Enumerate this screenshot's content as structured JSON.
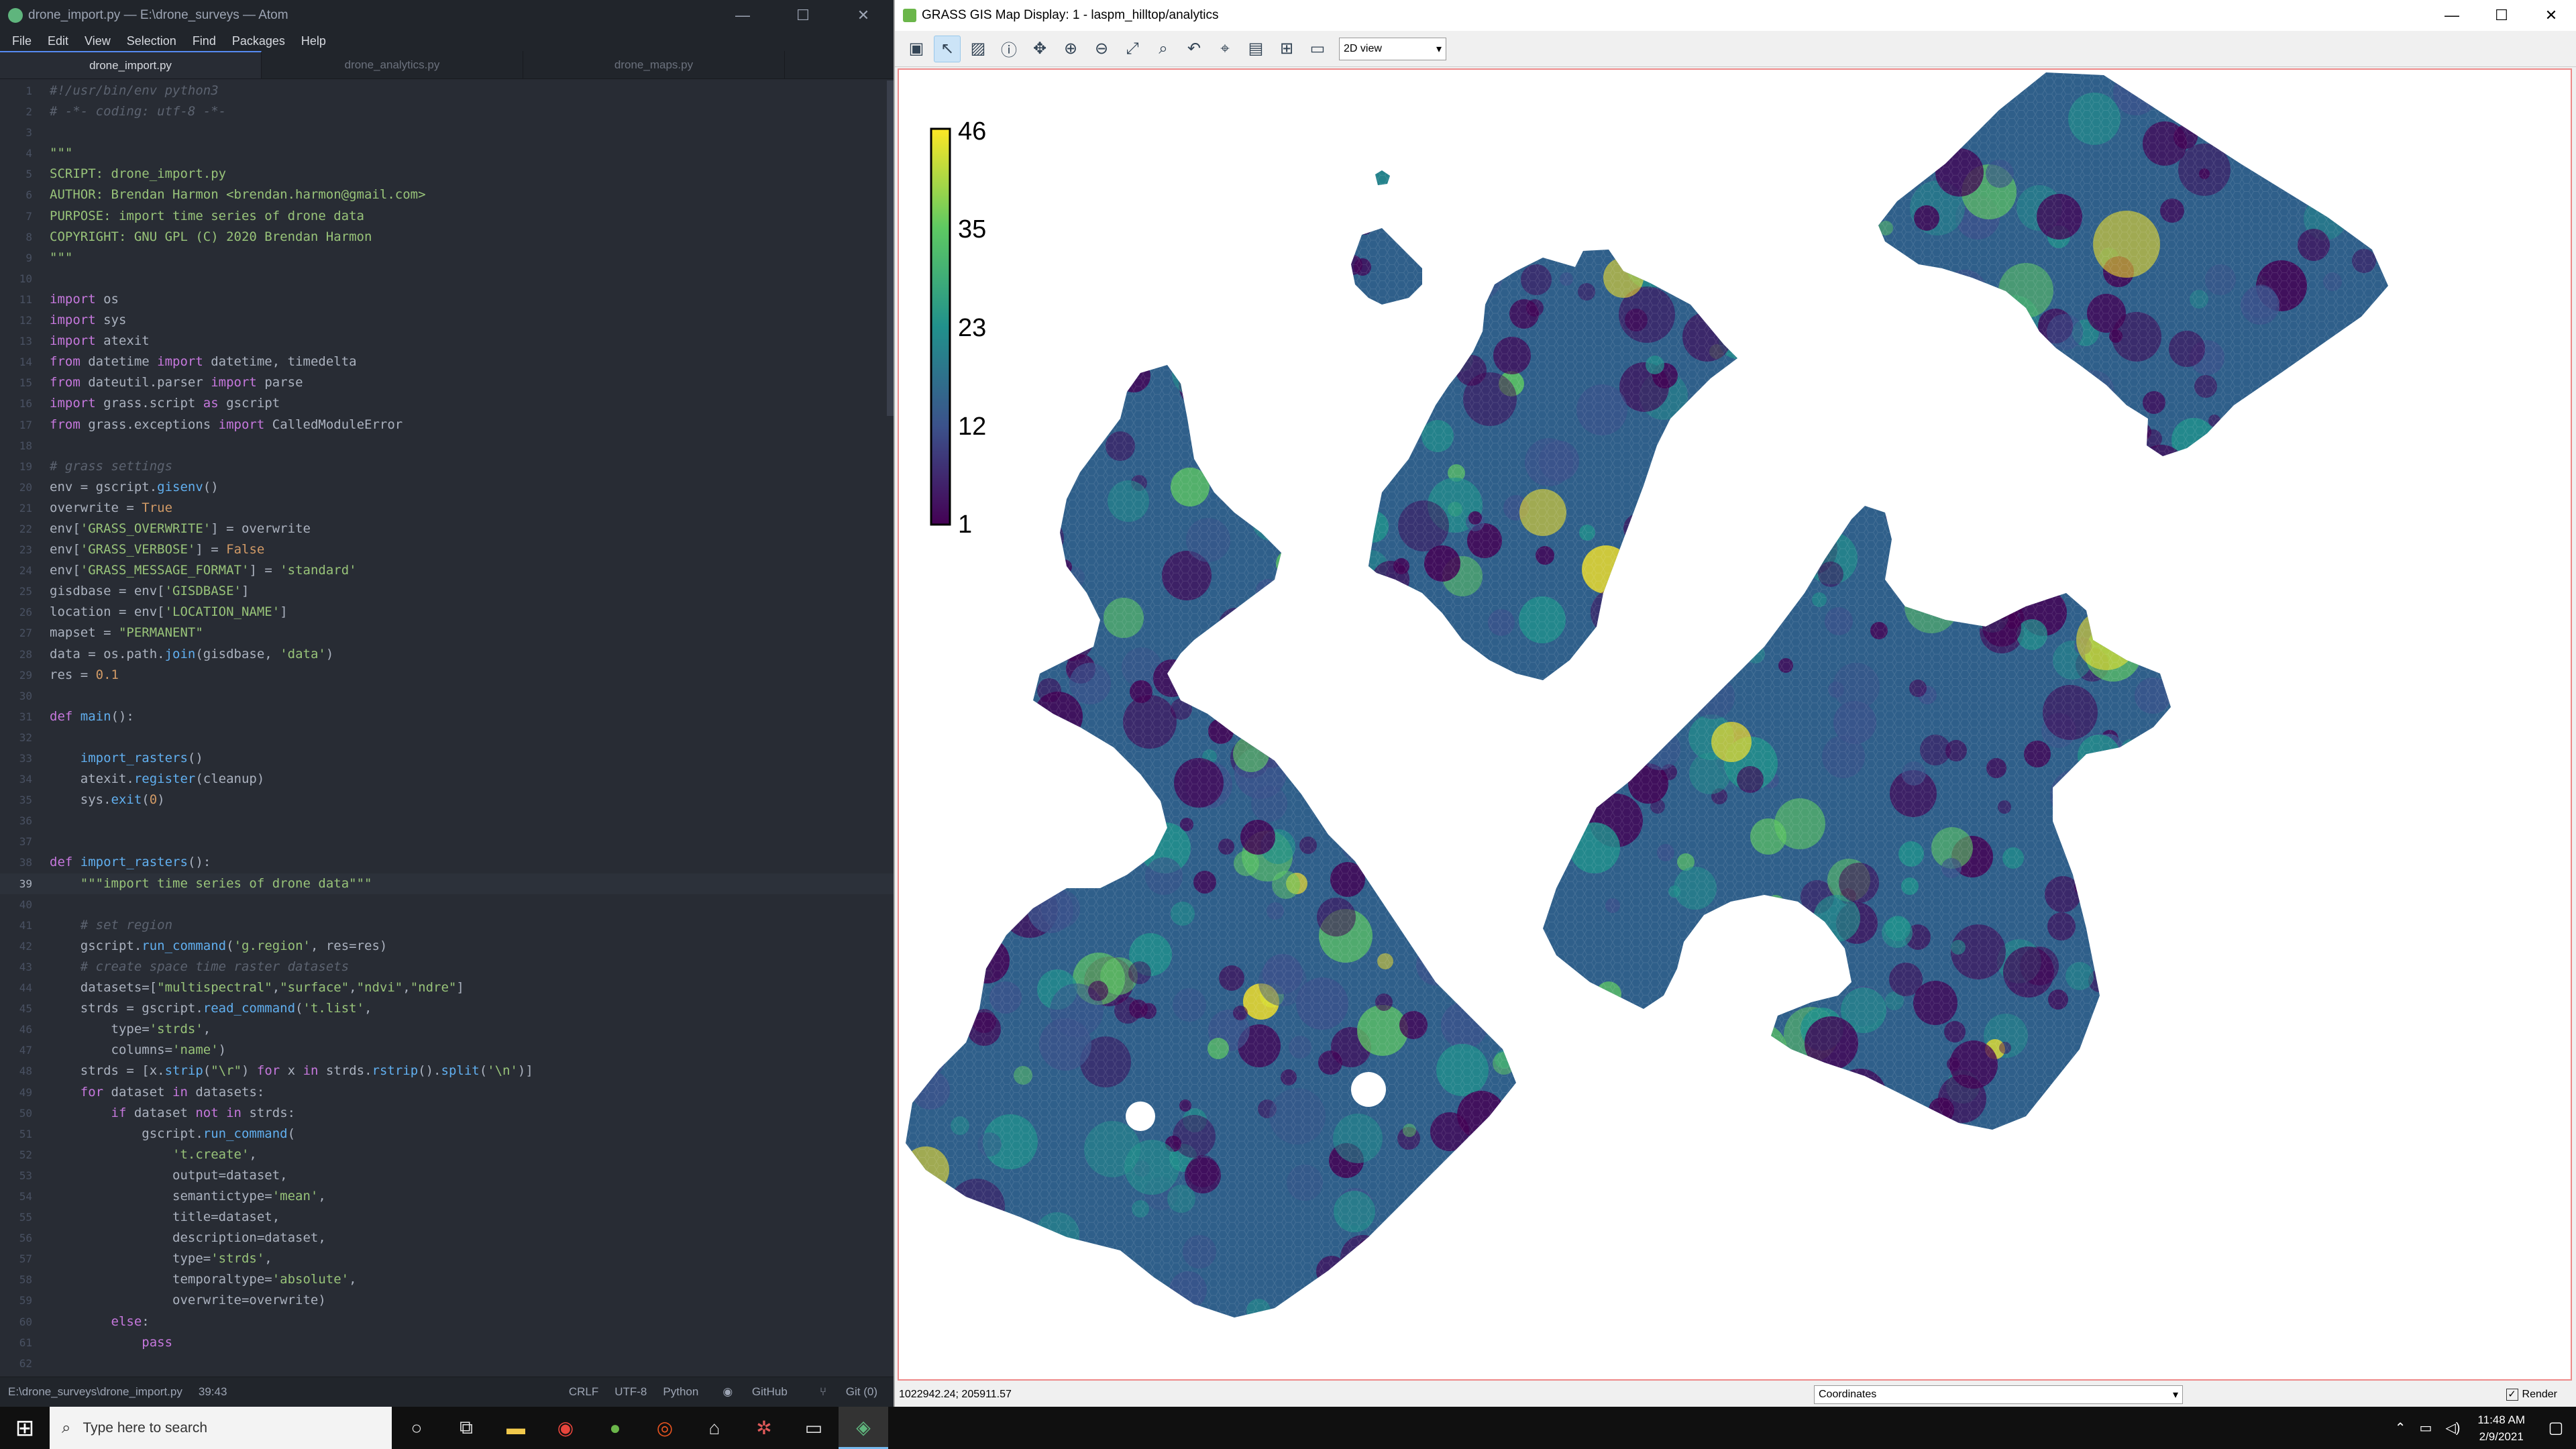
{
  "atom": {
    "title": "drone_import.py — E:\\drone_surveys — Atom",
    "menu": [
      "File",
      "Edit",
      "View",
      "Selection",
      "Find",
      "Packages",
      "Help"
    ],
    "tabs": [
      {
        "label": "drone_import.py",
        "active": true
      },
      {
        "label": "drone_analytics.py",
        "active": false
      },
      {
        "label": "drone_maps.py",
        "active": false
      }
    ],
    "status": {
      "path": "E:\\drone_surveys\\drone_import.py",
      "position": "39:43",
      "line_ending": "CRLF",
      "encoding": "UTF-8",
      "grammar": "Python",
      "github": "GitHub",
      "git": "Git (0)"
    }
  },
  "grass": {
    "title": "GRASS GIS Map Display: 1 - laspm_hilltop/analytics",
    "view_mode": "2D view",
    "coords": "1022942.24; 205911.57",
    "coords_mode": "Coordinates",
    "render_label": "Render",
    "legend": {
      "ticks": [
        "46",
        "35",
        "23",
        "12",
        "1"
      ],
      "min": 1,
      "max": 46
    }
  },
  "taskbar": {
    "search_placeholder": "Type here to search",
    "time": "11:48 AM",
    "date": "2/9/2021"
  },
  "window_controls": {
    "minimize": "—",
    "maximize": "☐",
    "close": "✕"
  },
  "toolbar_icons": [
    "display-map-icon",
    "pointer-icon",
    "select-icon",
    "query-icon",
    "pan-icon",
    "zoom-in-icon",
    "zoom-out-icon",
    "zoom-extent-icon",
    "zoom-region-icon",
    "zoom-back-icon",
    "zoom-menu-icon",
    "analyze-icon",
    "overlay-icon",
    "save-icon"
  ],
  "colors": {
    "viridis": [
      "#440154",
      "#3b528b",
      "#21918c",
      "#5ec962",
      "#fde725"
    ],
    "accent": "#568af2"
  },
  "code": [
    {
      "n": "1",
      "h": "<span class='c'>#!/usr/bin/env python3</span>"
    },
    {
      "n": "2",
      "h": "<span class='c'># -*- coding: utf-8 -*-</span>"
    },
    {
      "n": "3",
      "h": ""
    },
    {
      "n": "4",
      "h": "<span class='s'>\"\"\"</span>"
    },
    {
      "n": "5",
      "h": "<span class='s'>SCRIPT: drone_import.py</span>"
    },
    {
      "n": "6",
      "h": "<span class='s'>AUTHOR: Brendan Harmon &lt;brendan.harmon@gmail.com&gt;</span>"
    },
    {
      "n": "7",
      "h": "<span class='s'>PURPOSE: import time series of drone data</span>"
    },
    {
      "n": "8",
      "h": "<span class='s'>COPYRIGHT: GNU GPL (C) 2020 Brendan Harmon</span>"
    },
    {
      "n": "9",
      "h": "<span class='s'>\"\"\"</span>"
    },
    {
      "n": "10",
      "h": ""
    },
    {
      "n": "11",
      "h": "<span class='k'>import</span> os"
    },
    {
      "n": "12",
      "h": "<span class='k'>import</span> sys"
    },
    {
      "n": "13",
      "h": "<span class='k'>import</span> atexit"
    },
    {
      "n": "14",
      "h": "<span class='k'>from</span> datetime <span class='k'>import</span> datetime, timedelta"
    },
    {
      "n": "15",
      "h": "<span class='k'>from</span> dateutil.parser <span class='k'>import</span> parse"
    },
    {
      "n": "16",
      "h": "<span class='k'>import</span> grass.script <span class='k'>as</span> gscript"
    },
    {
      "n": "17",
      "h": "<span class='k'>from</span> grass.exceptions <span class='k'>import</span> CalledModuleError"
    },
    {
      "n": "18",
      "h": ""
    },
    {
      "n": "19",
      "h": "<span class='c'># grass settings</span>"
    },
    {
      "n": "20",
      "h": "env = gscript.<span class='f'>gisenv</span>()"
    },
    {
      "n": "21",
      "h": "overwrite = <span class='n'>True</span>"
    },
    {
      "n": "22",
      "h": "env[<span class='s'>'GRASS_OVERWRITE'</span>] = overwrite"
    },
    {
      "n": "23",
      "h": "env[<span class='s'>'GRASS_VERBOSE'</span>] = <span class='n'>False</span>"
    },
    {
      "n": "24",
      "h": "env[<span class='s'>'GRASS_MESSAGE_FORMAT'</span>] = <span class='s'>'standard'</span>"
    },
    {
      "n": "25",
      "h": "gisdbase = env[<span class='s'>'GISDBASE'</span>]"
    },
    {
      "n": "26",
      "h": "location = env[<span class='s'>'LOCATION_NAME'</span>]"
    },
    {
      "n": "27",
      "h": "mapset = <span class='s'>\"PERMANENT\"</span>"
    },
    {
      "n": "28",
      "h": "data = os.path.<span class='f'>join</span>(gisdbase, <span class='s'>'data'</span>)"
    },
    {
      "n": "29",
      "h": "res = <span class='n'>0.1</span>"
    },
    {
      "n": "30",
      "h": ""
    },
    {
      "n": "31",
      "h": "<span class='k'>def</span> <span class='f'>main</span>():"
    },
    {
      "n": "32",
      "h": ""
    },
    {
      "n": "33",
      "h": "    <span class='f'>import_rasters</span>()"
    },
    {
      "n": "34",
      "h": "    atexit.<span class='f'>register</span>(cleanup)"
    },
    {
      "n": "35",
      "h": "    sys.<span class='f'>exit</span>(<span class='n'>0</span>)"
    },
    {
      "n": "36",
      "h": ""
    },
    {
      "n": "37",
      "h": ""
    },
    {
      "n": "38",
      "h": "<span class='k'>def</span> <span class='f'>import_rasters</span>():"
    },
    {
      "n": "39",
      "h": "    <span class='s'>\"\"\"import time series of drone data\"\"\"</span>",
      "cursor": true
    },
    {
      "n": "40",
      "h": ""
    },
    {
      "n": "41",
      "h": "    <span class='c'># set region</span>"
    },
    {
      "n": "42",
      "h": "    gscript.<span class='f'>run_command</span>(<span class='s'>'g.region'</span>, res=res)"
    },
    {
      "n": "43",
      "h": "    <span class='c'># create space time raster datasets</span>"
    },
    {
      "n": "44",
      "h": "    datasets=[<span class='s'>\"multispectral\"</span>,<span class='s'>\"surface\"</span>,<span class='s'>\"ndvi\"</span>,<span class='s'>\"ndre\"</span>]"
    },
    {
      "n": "45",
      "h": "    strds = gscript.<span class='f'>read_command</span>(<span class='s'>'t.list'</span>,"
    },
    {
      "n": "46",
      "h": "        type=<span class='s'>'strds'</span>,"
    },
    {
      "n": "47",
      "h": "        columns=<span class='s'>'name'</span>)"
    },
    {
      "n": "48",
      "h": "    strds = [x.<span class='f'>strip</span>(<span class='s'>\"\\r\"</span>) <span class='k'>for</span> x <span class='k'>in</span> strds.<span class='f'>rstrip</span>().<span class='f'>split</span>(<span class='s'>'\\n'</span>)]"
    },
    {
      "n": "49",
      "h": "    <span class='k'>for</span> dataset <span class='k'>in</span> datasets:"
    },
    {
      "n": "50",
      "h": "        <span class='k'>if</span> dataset <span class='k'>not in</span> strds:"
    },
    {
      "n": "51",
      "h": "            gscript.<span class='f'>run_command</span>("
    },
    {
      "n": "52",
      "h": "                <span class='s'>'t.create'</span>,"
    },
    {
      "n": "53",
      "h": "                output=dataset,"
    },
    {
      "n": "54",
      "h": "                semantictype=<span class='s'>'mean'</span>,"
    },
    {
      "n": "55",
      "h": "                title=dataset,"
    },
    {
      "n": "56",
      "h": "                description=dataset,"
    },
    {
      "n": "57",
      "h": "                type=<span class='s'>'strds'</span>,"
    },
    {
      "n": "58",
      "h": "                temporaltype=<span class='s'>'absolute'</span>,"
    },
    {
      "n": "59",
      "h": "                overwrite=overwrite)"
    },
    {
      "n": "60",
      "h": "        <span class='k'>else</span>:"
    },
    {
      "n": "61",
      "h": "            <span class='k'>pass</span>"
    },
    {
      "n": "62",
      "h": ""
    }
  ]
}
